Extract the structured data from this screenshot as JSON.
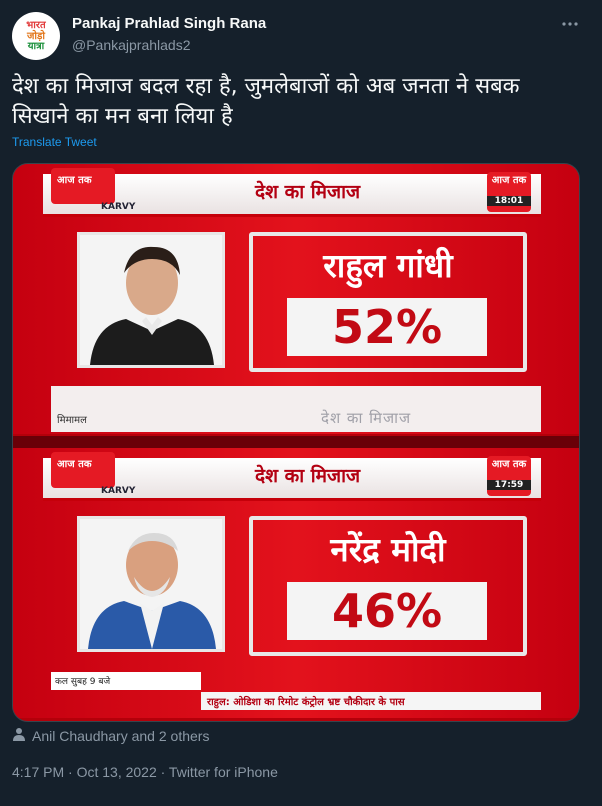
{
  "author": {
    "name": "Pankaj Prahlad Singh Rana",
    "handle": "@Pankajprahlads2",
    "avatar_text": [
      "भारत",
      "जोड़ो",
      "यात्रा"
    ]
  },
  "tweet": {
    "text_line1": "देश का मिजाज बदल रहा है, जुमलेबाजों को अब जनता ने सबक",
    "text_line2": "सिखाने का मन बना लिया है",
    "translate_label": "Translate Tweet"
  },
  "media": {
    "panels": [
      {
        "header": "देश का मिजाज",
        "sponsor": "KARVY",
        "channel_time": "18:01",
        "person": "राहुल गांधी",
        "percent": "52%",
        "ticker_left": "मिमामल",
        "ticker_right": "देश का मिजाज"
      },
      {
        "header": "देश का मिजाज",
        "sponsor": "KARVY",
        "channel_time": "17:59",
        "person": "नरेंद्र मोदी",
        "percent": "46%",
        "ticker_tag": "कल सुबह 9 बजे",
        "ticker_bar": "राहुल: ओडिशा का रिमोट कंट्रोल भ्रष्ट चौकीदार के पास"
      }
    ]
  },
  "engagement": {
    "liked_by": "Anil Chaudhary and 2 others"
  },
  "meta": {
    "timestamp": "4:17 PM · Oct 13, 2022 · Twitter for iPhone"
  },
  "icons": {
    "more": "more-options-icon",
    "person": "person-icon"
  },
  "colors": {
    "background": "#15202b",
    "link": "#1d9bf0",
    "muted": "#8b98a5"
  }
}
